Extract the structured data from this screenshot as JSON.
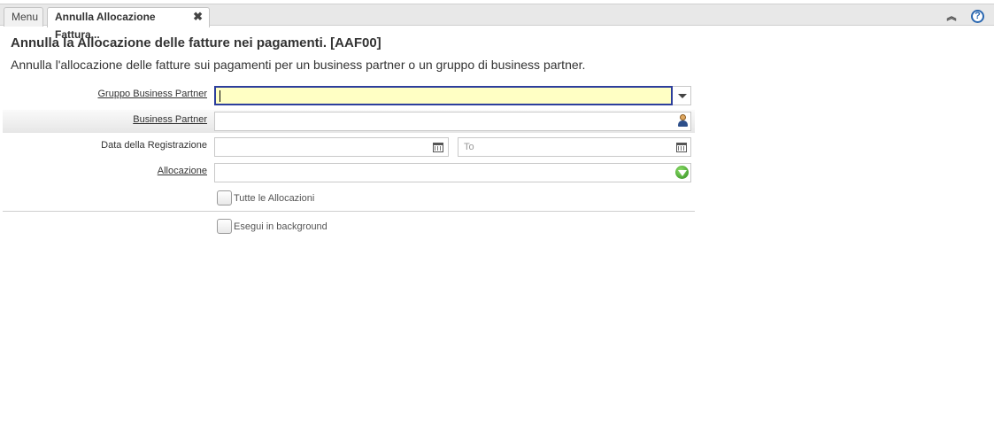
{
  "tabs": {
    "menu_label": "Menu",
    "active_label": "Annulla Allocazione Fattura...",
    "close_glyph": "✖"
  },
  "header": {
    "title": "Annulla la Allocazione delle fatture nei pagamenti. [AAF00]",
    "description": "Annulla l'allocazione delle fatture sui pagamenti per un business partner o un gruppo di business partner."
  },
  "form": {
    "gruppo_bp": {
      "label": "Gruppo Business Partner",
      "value": ""
    },
    "business_partner": {
      "label": "Business Partner",
      "value": ""
    },
    "data_registrazione": {
      "label": "Data della Registrazione",
      "from_value": "",
      "to_placeholder": "To"
    },
    "allocazione": {
      "label": "Allocazione",
      "value": ""
    },
    "tutte_allocazioni": {
      "label": "Tutte le Allocazioni",
      "checked": false
    },
    "esegui_background": {
      "label": "Esegui in background",
      "checked": false
    }
  },
  "icons": {
    "collapse": "double-chevron-up-icon",
    "help": "help-icon",
    "dropdown": "chevron-down-icon",
    "business_partner": "business-partner-icon",
    "calendar": "calendar-icon",
    "allocation": "allocation-search-icon"
  },
  "colors": {
    "focus_bg": "#ffffc4",
    "focus_border": "#2c3e9c",
    "help_blue": "#2a67b0"
  }
}
